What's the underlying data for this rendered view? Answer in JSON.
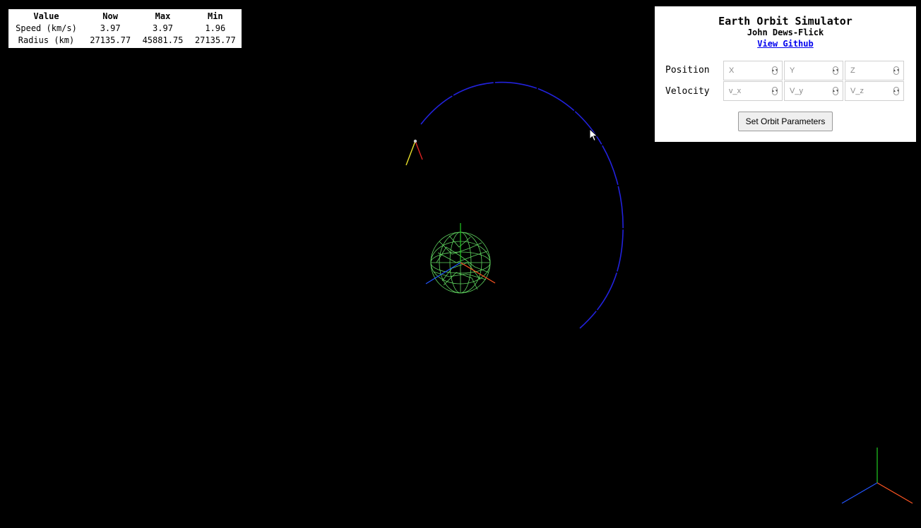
{
  "stats": {
    "headers": [
      "Value",
      "Now",
      "Max",
      "Min"
    ],
    "rows": [
      {
        "label": "Speed (km/s)",
        "now": "3.97",
        "max": "3.97",
        "min": "1.96"
      },
      {
        "label": "Radius (km)",
        "now": "27135.77",
        "max": "45881.75",
        "min": "27135.77"
      }
    ]
  },
  "panel": {
    "title": "Earth Orbit Simulator",
    "author": "John Dews-Flick",
    "link_label": "View Github",
    "position_label": "Position",
    "velocity_label": "Velocity",
    "position_placeholders": [
      "X",
      "Y",
      "Z"
    ],
    "velocity_placeholders": [
      "v_x",
      "V_y",
      "V_z"
    ],
    "button_label": "Set Orbit Parameters"
  },
  "scene": {
    "colors": {
      "earth_wireframe": "#5fd35f",
      "orbit_trail": "#2222dd",
      "axis_x": "#ff5522",
      "axis_y": "#22cc22",
      "axis_z": "#2255ff",
      "velocity_vector": "#e8e02a",
      "acceleration_vector": "#dd2222",
      "satellite": "#cccccc"
    },
    "icons": [
      "earth-wireframe-icon",
      "satellite-icon",
      "axes-gizmo-icon",
      "mouse-cursor-icon"
    ]
  }
}
